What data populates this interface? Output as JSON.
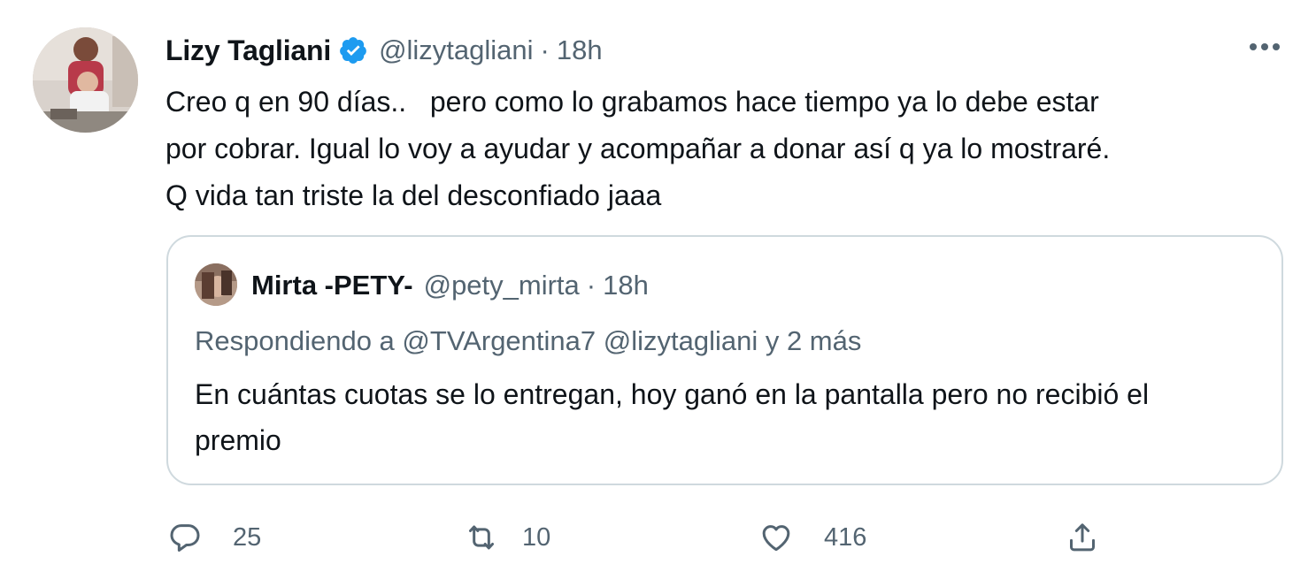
{
  "tweet": {
    "author_name": "Lizy Tagliani",
    "author_handle": "@lizytagliani",
    "separator": "·",
    "time": "18h",
    "text": "Creo q en 90 días..   pero como lo grabamos hace tiempo ya lo debe estar\npor cobrar. Igual lo voy a ayudar y acompañar a donar así q ya lo mostraré.\nQ vida tan triste la del desconfiado jaaa"
  },
  "quote": {
    "author_name": "Mirta -PETY-",
    "author_handle": "@pety_mirta",
    "separator": "·",
    "time": "18h",
    "reply_to": "Respondiendo a @TVArgentina7 @lizytagliani y 2 más",
    "text": "En cuántas cuotas se lo entregan, hoy ganó en la pantalla pero no recibió el premio"
  },
  "actions": {
    "replies": "25",
    "retweets": "10",
    "likes": "416"
  },
  "icons": {
    "verified": "verified-badge-icon",
    "more": "more-horizontal-icon",
    "reply": "reply-icon",
    "retweet": "retweet-icon",
    "like": "heart-icon",
    "share": "share-icon"
  },
  "colors": {
    "accent": "#1d9bf0",
    "text_primary": "#0f1419",
    "text_secondary": "#536471",
    "border": "#cfd9de"
  }
}
